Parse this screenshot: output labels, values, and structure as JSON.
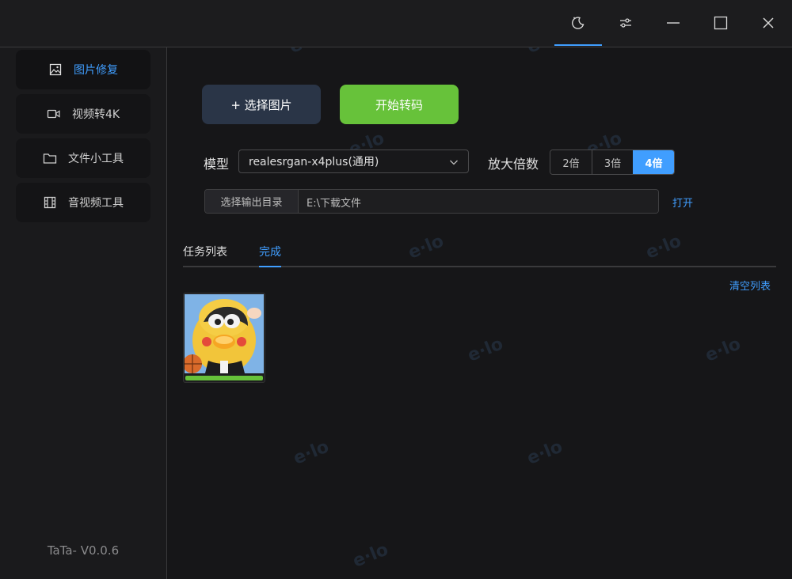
{
  "titlebar": {
    "icons": [
      "moon-icon",
      "settings-sliders-icon",
      "minimize-icon",
      "maximize-icon",
      "close-icon"
    ]
  },
  "sidebar": {
    "items": [
      {
        "label": "图片修复",
        "icon": "image-icon",
        "active": true
      },
      {
        "label": "视频转4K",
        "icon": "video-icon",
        "active": false
      },
      {
        "label": "文件小工具",
        "icon": "folder-icon",
        "active": false
      },
      {
        "label": "音视频工具",
        "icon": "film-icon",
        "active": false
      }
    ],
    "version": "TaTa- V0.0.6"
  },
  "main": {
    "select_button": "+ 选择图片",
    "start_button": "开始转码",
    "model_label": "模型",
    "model_value": "realesrgan-x4plus(通用)",
    "scale_label": "放大倍数",
    "scale_options": [
      "2倍",
      "3倍",
      "4倍"
    ],
    "scale_selected": "4倍",
    "output_label": "选择输出目录",
    "output_path": "E:\\下载文件",
    "open_link": "打开",
    "tabs": [
      "任务列表",
      "完成"
    ],
    "active_tab": "完成",
    "clear_list": "清空列表",
    "task": {
      "progress": 1.0
    }
  },
  "colors": {
    "accent": "#409eff",
    "success": "#67c23a",
    "background": "#161618"
  }
}
